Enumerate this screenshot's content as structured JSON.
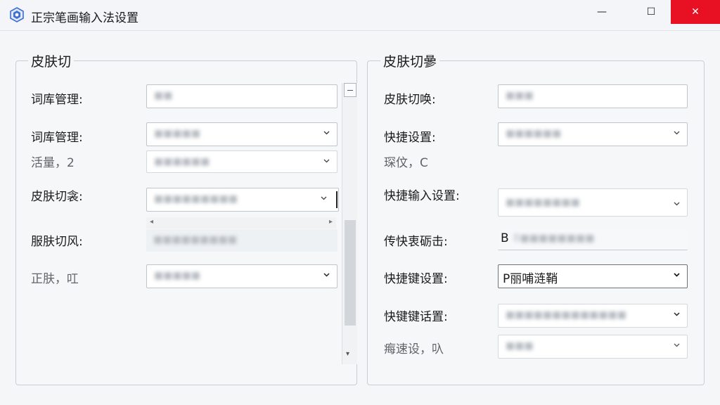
{
  "window": {
    "title": "正宗笔画输入法设置",
    "min_glyph": "—",
    "max_glyph": "☐",
    "close_glyph": "✕"
  },
  "left_group": {
    "title": "皮肤切",
    "rows": [
      {
        "label": "词库管理:",
        "value": "■■"
      },
      {
        "label": "词库管理:",
        "value": "■■■■■"
      },
      {
        "label": "活量，2",
        "value": "■■■■■■"
      },
      {
        "label": "皮肤切衾:",
        "value": "■■■■■■■■■"
      },
      {
        "label": "服肤切风:",
        "value": "■■■■■■■■■"
      },
      {
        "label": "正肤，叿",
        "value": "■■■■■"
      }
    ]
  },
  "right_group": {
    "title": "皮肤切曑",
    "rows": [
      {
        "label": "皮肤切唤:",
        "value": "■■■"
      },
      {
        "label": "快捷设置:",
        "value": "■■■■■■"
      },
      {
        "label": "琛伩，C",
        "value": ""
      },
      {
        "label": "快捷输入设置:",
        "value": "■■■■■■■■"
      },
      {
        "label": "传快衷砺击:",
        "value": "B■■■■■■■■"
      },
      {
        "label": "快捷键设置:",
        "value": "P ■■■■■■"
      },
      {
        "label": "快键键话置:",
        "value": "■■■■■■■■■■■■■"
      },
      {
        "label": "痗速设，叺",
        "value": "■■■"
      }
    ],
    "field_b_prefix": "B",
    "field_p_text": "P丽哺涟鞘"
  },
  "colors": {
    "close_button": "#e81123",
    "app_icon": "#3f6fd0"
  },
  "icons": {
    "app": "app-logo-icon",
    "chevron": "chevron-down-icon"
  }
}
